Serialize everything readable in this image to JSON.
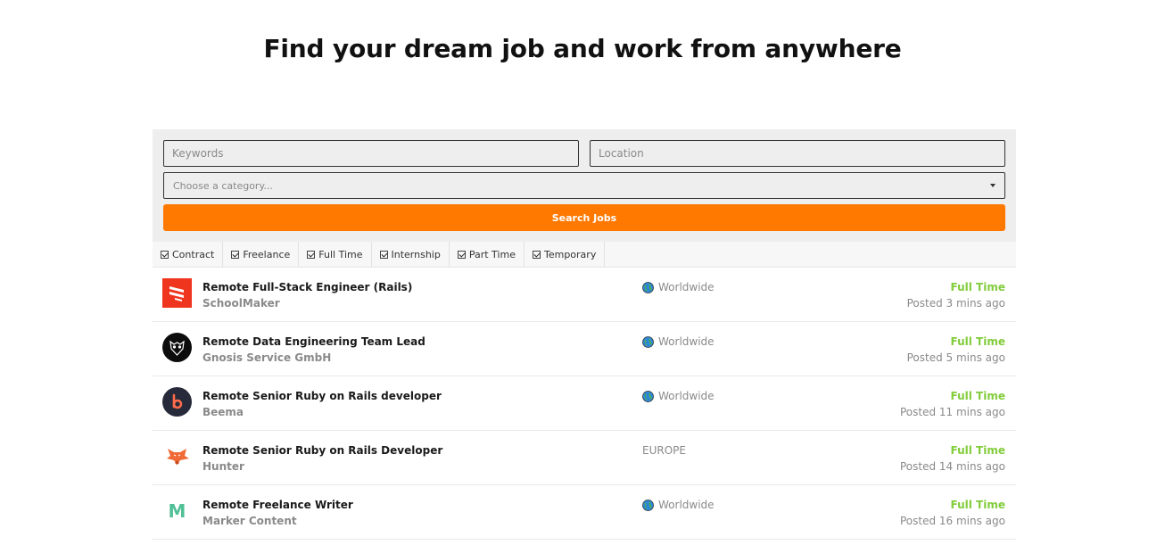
{
  "headline": "Find your dream job and work from anywhere",
  "search": {
    "keywords_placeholder": "Keywords",
    "location_placeholder": "Location",
    "category_placeholder": "Choose a category...",
    "button_label": "Search Jobs"
  },
  "filters": [
    "Contract",
    "Freelance",
    "Full Time",
    "Internship",
    "Part Time",
    "Temporary"
  ],
  "jobs": [
    {
      "title": "Remote Full-Stack Engineer (Rails)",
      "company": "SchoolMaker",
      "location": "Worldwide",
      "type": "Full Time",
      "posted": "Posted 3 mins ago",
      "logo_icon": "schoolmaker-logo-icon"
    },
    {
      "title": "Remote Data Engineering Team Lead",
      "company": "Gnosis Service GmbH",
      "location": "Worldwide",
      "type": "Full Time",
      "posted": "Posted 5 mins ago",
      "logo_icon": "gnosis-owl-logo-icon"
    },
    {
      "title": "Remote Senior Ruby on Rails developer",
      "company": "Beema",
      "location": "Worldwide",
      "type": "Full Time",
      "posted": "Posted 11 mins ago",
      "logo_icon": "beema-logo-icon"
    },
    {
      "title": "Remote Senior Ruby on Rails Developer",
      "company": "Hunter",
      "location": "EUROPE",
      "type": "Full Time",
      "posted": "Posted 14 mins ago",
      "logo_icon": "hunter-fox-logo-icon"
    },
    {
      "title": "Remote Freelance Writer",
      "company": "Marker Content",
      "location": "Worldwide",
      "type": "Full Time",
      "posted": "Posted 16 mins ago",
      "logo_icon": "marker-content-logo-icon",
      "logo_letter": "M"
    }
  ],
  "colors": {
    "accent": "#ff7800",
    "job_type": "#82cc3b",
    "panel_bg": "#eeeeee"
  }
}
